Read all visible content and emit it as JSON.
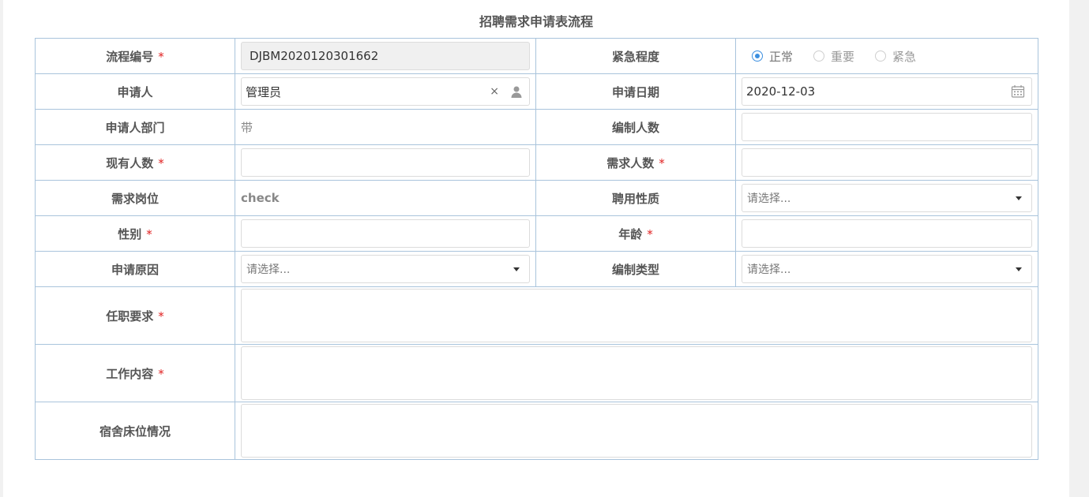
{
  "title": "招聘需求申请表流程",
  "required_mark": "*",
  "fields": {
    "process_no": {
      "label": "流程编号",
      "value": "DJBM2020120301662"
    },
    "urgency": {
      "label": "紧急程度",
      "options": [
        "正常",
        "重要",
        "紧急"
      ],
      "selected": "正常"
    },
    "applicant": {
      "label": "申请人",
      "value": "管理员",
      "clear": "×"
    },
    "apply_date": {
      "label": "申请日期",
      "value": "2020-12-03"
    },
    "applicant_dept": {
      "label": "申请人部门",
      "value": "带"
    },
    "staffing_count": {
      "label": "编制人数",
      "value": ""
    },
    "current_count": {
      "label": "现有人数",
      "value": ""
    },
    "demand_count": {
      "label": "需求人数",
      "value": ""
    },
    "position": {
      "label": "需求岗位",
      "value": "check"
    },
    "employment_type": {
      "label": "聘用性质",
      "placeholder": "请选择..."
    },
    "gender": {
      "label": "性别",
      "value": ""
    },
    "age": {
      "label": "年龄",
      "value": ""
    },
    "reason": {
      "label": "申请原因",
      "placeholder": "请选择..."
    },
    "staffing_type": {
      "label": "编制类型",
      "placeholder": "请选择..."
    },
    "requirements": {
      "label": "任职要求",
      "value": ""
    },
    "job_content": {
      "label": "工作内容",
      "value": ""
    },
    "dorm": {
      "label": "宿舍床位情况",
      "value": ""
    }
  }
}
